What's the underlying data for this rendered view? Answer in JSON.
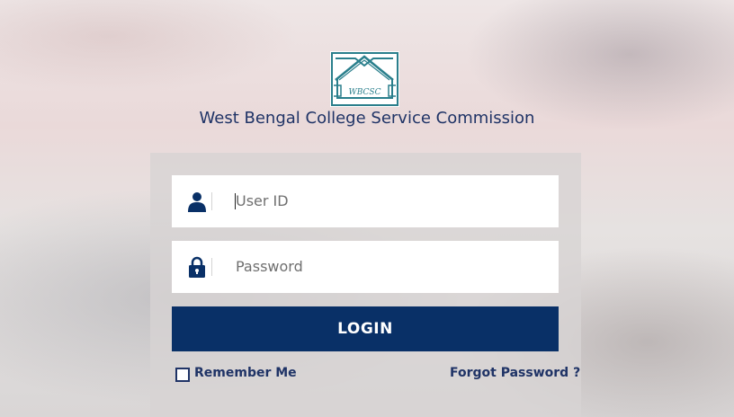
{
  "header": {
    "logo_text": "WBCSC",
    "title": "West Bengal College Service Commission"
  },
  "form": {
    "user_id": {
      "placeholder": "User ID",
      "value": ""
    },
    "password": {
      "placeholder": "Password",
      "value": ""
    },
    "login_label": "LOGIN",
    "remember_label": "Remember Me",
    "remember_checked": false,
    "forgot_label": "Forgot Password ?"
  },
  "colors": {
    "primary": "#093067",
    "text": "#1f3366",
    "logo": "#2a7f8c"
  },
  "icons": {
    "user": "user-icon",
    "password": "lock-icon"
  }
}
